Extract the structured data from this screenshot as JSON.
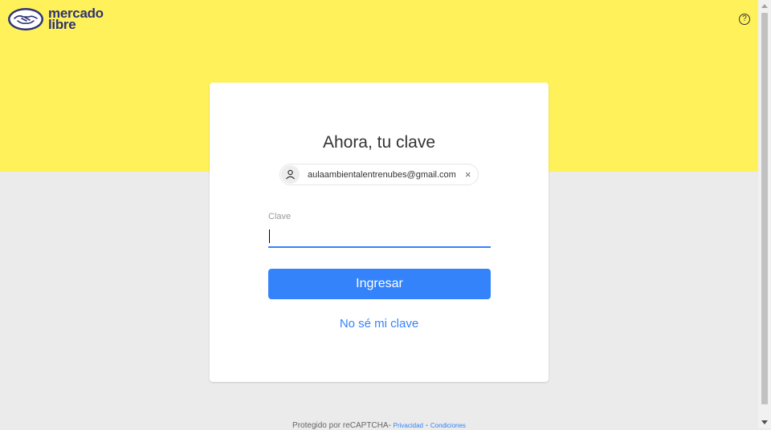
{
  "brand": {
    "name_line1": "mercado",
    "name_line2": "libre",
    "yellow": "#fff159",
    "accent": "#3483fa"
  },
  "header": {
    "help_icon": "?"
  },
  "card": {
    "title": "Ahora, tu clave",
    "account_email": "aulaambientalentrenubes@gmail.com",
    "remove_icon": "×",
    "password_label": "Clave",
    "password_value": "",
    "submit_label": "Ingresar",
    "forgot_link": "No sé mi clave"
  },
  "footer": {
    "text": "Protegido por reCAPTCHA- ",
    "privacy": "Privacidad",
    "separator": " - ",
    "terms": "Condiciones"
  }
}
